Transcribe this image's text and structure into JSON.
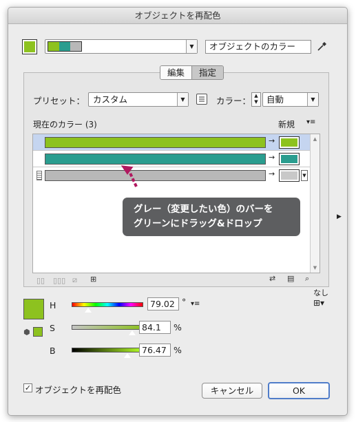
{
  "window": {
    "title": "オブジェクトを再配色"
  },
  "top": {
    "target_label": "オブジェクトのカラー",
    "current_swatch_color": "#8dc21f",
    "group_colors": [
      "#8dc21f",
      "#2a9d8f",
      "#b8b8b8"
    ]
  },
  "tabs": [
    {
      "label": "編集",
      "active": false
    },
    {
      "label": "指定",
      "active": true
    }
  ],
  "preset": {
    "label": "プリセット：",
    "value": "カスタム"
  },
  "colors": {
    "label": "カラー：",
    "value": "自動"
  },
  "list": {
    "header": "現在のカラー (3)",
    "new_header": "新規",
    "rows": [
      {
        "current": "#8dc21f",
        "new": "#8dc21f",
        "selected": true
      },
      {
        "current": "#2a9d8f",
        "new": "#2a9d8f",
        "selected": false
      },
      {
        "current": "#b8b8b8",
        "new": "#c8c8c8",
        "selected": false
      }
    ]
  },
  "tooltip": {
    "line1": "グレー（変更したい色）のバーを",
    "line2": "グリーンにドラッグ&ドロップ"
  },
  "hsb": {
    "swatch_color": "#8dc21f",
    "h_label": "H",
    "h_value": "79.02",
    "h_unit": "°",
    "s_label": "S",
    "s_value": "84.1",
    "s_unit": "%",
    "b_label": "B",
    "b_value": "76.47",
    "b_unit": "%",
    "h_position": 0.22,
    "s_position": 0.84,
    "b_position": 0.765
  },
  "none_label": "なし",
  "footer": {
    "checkbox_label": "オブジェクトを再配色",
    "checked": true,
    "cancel": "キャンセル",
    "ok": "OK"
  }
}
